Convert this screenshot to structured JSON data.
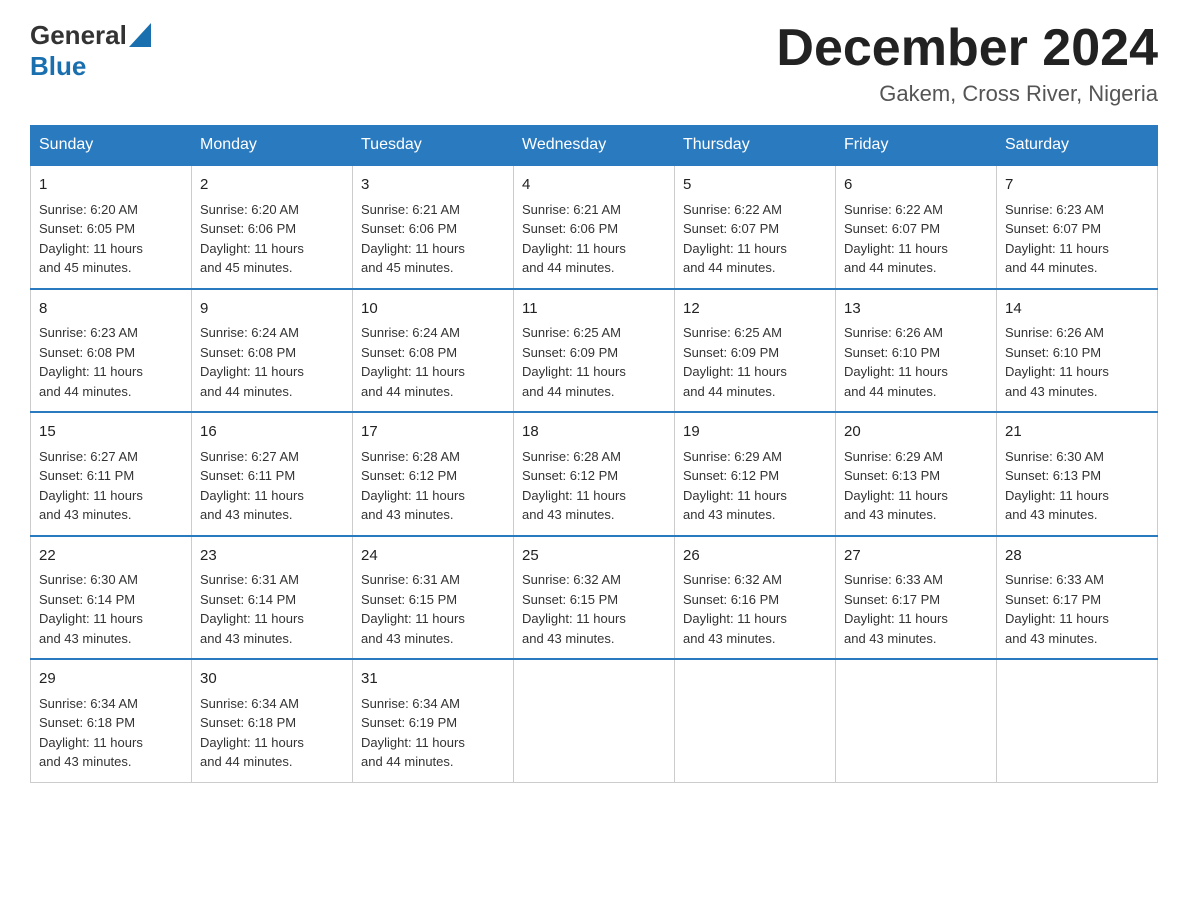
{
  "header": {
    "logo_general": "General",
    "logo_blue": "Blue",
    "month_title": "December 2024",
    "location": "Gakem, Cross River, Nigeria"
  },
  "columns": [
    "Sunday",
    "Monday",
    "Tuesday",
    "Wednesday",
    "Thursday",
    "Friday",
    "Saturday"
  ],
  "weeks": [
    [
      {
        "day": "1",
        "sunrise": "Sunrise: 6:20 AM",
        "sunset": "Sunset: 6:05 PM",
        "daylight": "Daylight: 11 hours",
        "daylight2": "and 45 minutes."
      },
      {
        "day": "2",
        "sunrise": "Sunrise: 6:20 AM",
        "sunset": "Sunset: 6:06 PM",
        "daylight": "Daylight: 11 hours",
        "daylight2": "and 45 minutes."
      },
      {
        "day": "3",
        "sunrise": "Sunrise: 6:21 AM",
        "sunset": "Sunset: 6:06 PM",
        "daylight": "Daylight: 11 hours",
        "daylight2": "and 45 minutes."
      },
      {
        "day": "4",
        "sunrise": "Sunrise: 6:21 AM",
        "sunset": "Sunset: 6:06 PM",
        "daylight": "Daylight: 11 hours",
        "daylight2": "and 44 minutes."
      },
      {
        "day": "5",
        "sunrise": "Sunrise: 6:22 AM",
        "sunset": "Sunset: 6:07 PM",
        "daylight": "Daylight: 11 hours",
        "daylight2": "and 44 minutes."
      },
      {
        "day": "6",
        "sunrise": "Sunrise: 6:22 AM",
        "sunset": "Sunset: 6:07 PM",
        "daylight": "Daylight: 11 hours",
        "daylight2": "and 44 minutes."
      },
      {
        "day": "7",
        "sunrise": "Sunrise: 6:23 AM",
        "sunset": "Sunset: 6:07 PM",
        "daylight": "Daylight: 11 hours",
        "daylight2": "and 44 minutes."
      }
    ],
    [
      {
        "day": "8",
        "sunrise": "Sunrise: 6:23 AM",
        "sunset": "Sunset: 6:08 PM",
        "daylight": "Daylight: 11 hours",
        "daylight2": "and 44 minutes."
      },
      {
        "day": "9",
        "sunrise": "Sunrise: 6:24 AM",
        "sunset": "Sunset: 6:08 PM",
        "daylight": "Daylight: 11 hours",
        "daylight2": "and 44 minutes."
      },
      {
        "day": "10",
        "sunrise": "Sunrise: 6:24 AM",
        "sunset": "Sunset: 6:08 PM",
        "daylight": "Daylight: 11 hours",
        "daylight2": "and 44 minutes."
      },
      {
        "day": "11",
        "sunrise": "Sunrise: 6:25 AM",
        "sunset": "Sunset: 6:09 PM",
        "daylight": "Daylight: 11 hours",
        "daylight2": "and 44 minutes."
      },
      {
        "day": "12",
        "sunrise": "Sunrise: 6:25 AM",
        "sunset": "Sunset: 6:09 PM",
        "daylight": "Daylight: 11 hours",
        "daylight2": "and 44 minutes."
      },
      {
        "day": "13",
        "sunrise": "Sunrise: 6:26 AM",
        "sunset": "Sunset: 6:10 PM",
        "daylight": "Daylight: 11 hours",
        "daylight2": "and 44 minutes."
      },
      {
        "day": "14",
        "sunrise": "Sunrise: 6:26 AM",
        "sunset": "Sunset: 6:10 PM",
        "daylight": "Daylight: 11 hours",
        "daylight2": "and 43 minutes."
      }
    ],
    [
      {
        "day": "15",
        "sunrise": "Sunrise: 6:27 AM",
        "sunset": "Sunset: 6:11 PM",
        "daylight": "Daylight: 11 hours",
        "daylight2": "and 43 minutes."
      },
      {
        "day": "16",
        "sunrise": "Sunrise: 6:27 AM",
        "sunset": "Sunset: 6:11 PM",
        "daylight": "Daylight: 11 hours",
        "daylight2": "and 43 minutes."
      },
      {
        "day": "17",
        "sunrise": "Sunrise: 6:28 AM",
        "sunset": "Sunset: 6:12 PM",
        "daylight": "Daylight: 11 hours",
        "daylight2": "and 43 minutes."
      },
      {
        "day": "18",
        "sunrise": "Sunrise: 6:28 AM",
        "sunset": "Sunset: 6:12 PM",
        "daylight": "Daylight: 11 hours",
        "daylight2": "and 43 minutes."
      },
      {
        "day": "19",
        "sunrise": "Sunrise: 6:29 AM",
        "sunset": "Sunset: 6:12 PM",
        "daylight": "Daylight: 11 hours",
        "daylight2": "and 43 minutes."
      },
      {
        "day": "20",
        "sunrise": "Sunrise: 6:29 AM",
        "sunset": "Sunset: 6:13 PM",
        "daylight": "Daylight: 11 hours",
        "daylight2": "and 43 minutes."
      },
      {
        "day": "21",
        "sunrise": "Sunrise: 6:30 AM",
        "sunset": "Sunset: 6:13 PM",
        "daylight": "Daylight: 11 hours",
        "daylight2": "and 43 minutes."
      }
    ],
    [
      {
        "day": "22",
        "sunrise": "Sunrise: 6:30 AM",
        "sunset": "Sunset: 6:14 PM",
        "daylight": "Daylight: 11 hours",
        "daylight2": "and 43 minutes."
      },
      {
        "day": "23",
        "sunrise": "Sunrise: 6:31 AM",
        "sunset": "Sunset: 6:14 PM",
        "daylight": "Daylight: 11 hours",
        "daylight2": "and 43 minutes."
      },
      {
        "day": "24",
        "sunrise": "Sunrise: 6:31 AM",
        "sunset": "Sunset: 6:15 PM",
        "daylight": "Daylight: 11 hours",
        "daylight2": "and 43 minutes."
      },
      {
        "day": "25",
        "sunrise": "Sunrise: 6:32 AM",
        "sunset": "Sunset: 6:15 PM",
        "daylight": "Daylight: 11 hours",
        "daylight2": "and 43 minutes."
      },
      {
        "day": "26",
        "sunrise": "Sunrise: 6:32 AM",
        "sunset": "Sunset: 6:16 PM",
        "daylight": "Daylight: 11 hours",
        "daylight2": "and 43 minutes."
      },
      {
        "day": "27",
        "sunrise": "Sunrise: 6:33 AM",
        "sunset": "Sunset: 6:17 PM",
        "daylight": "Daylight: 11 hours",
        "daylight2": "and 43 minutes."
      },
      {
        "day": "28",
        "sunrise": "Sunrise: 6:33 AM",
        "sunset": "Sunset: 6:17 PM",
        "daylight": "Daylight: 11 hours",
        "daylight2": "and 43 minutes."
      }
    ],
    [
      {
        "day": "29",
        "sunrise": "Sunrise: 6:34 AM",
        "sunset": "Sunset: 6:18 PM",
        "daylight": "Daylight: 11 hours",
        "daylight2": "and 43 minutes."
      },
      {
        "day": "30",
        "sunrise": "Sunrise: 6:34 AM",
        "sunset": "Sunset: 6:18 PM",
        "daylight": "Daylight: 11 hours",
        "daylight2": "and 44 minutes."
      },
      {
        "day": "31",
        "sunrise": "Sunrise: 6:34 AM",
        "sunset": "Sunset: 6:19 PM",
        "daylight": "Daylight: 11 hours",
        "daylight2": "and 44 minutes."
      },
      null,
      null,
      null,
      null
    ]
  ]
}
